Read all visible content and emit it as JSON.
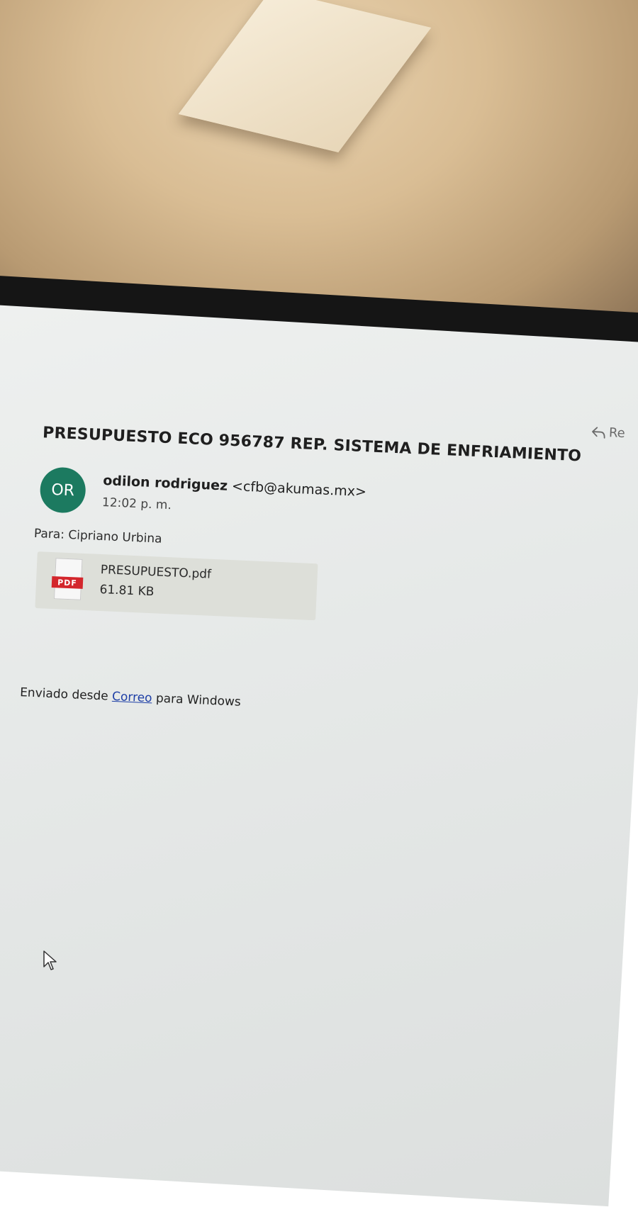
{
  "email": {
    "subject": "PRESUPUESTO ECO 956787 REP. SISTEMA DE ENFRIAMIENTO",
    "reply_label": "Re",
    "sender": {
      "initials": "OR",
      "name": "odilon rodriguez",
      "email": "<cfb@akumas.mx>",
      "time": "12:02 p. m.",
      "avatar_color": "#1c7a60"
    },
    "to_label": "Para:",
    "to_name": "Cipriano Urbina",
    "attachment": {
      "icon": "pdf-file-icon",
      "icon_label": "PDF",
      "file_name": "PRESUPUESTO.pdf",
      "file_size": "61.81 KB"
    },
    "footer": {
      "prefix": "Enviado desde",
      "link": "Correo",
      "suffix": "para Windows",
      "link_color": "#1e3fa6"
    }
  }
}
